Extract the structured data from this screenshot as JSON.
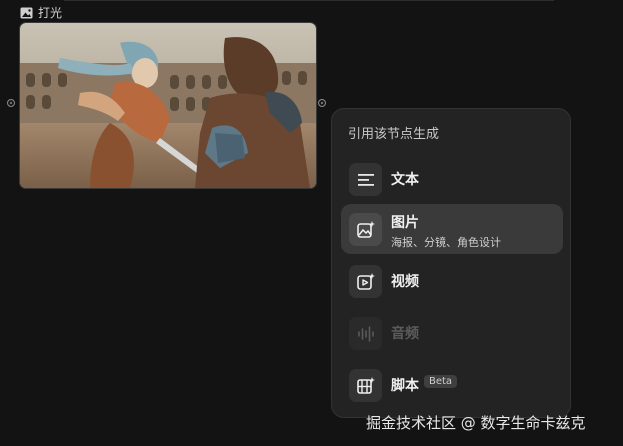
{
  "node": {
    "title": "打光"
  },
  "menu": {
    "title": "引用该节点生成",
    "items": [
      {
        "label": "文本",
        "icon": "text-lines-icon",
        "state": "normal"
      },
      {
        "label": "图片",
        "sub": "海报、分镜、角色设计",
        "icon": "image-sparkle-icon",
        "state": "active"
      },
      {
        "label": "视频",
        "icon": "video-sparkle-icon",
        "state": "normal"
      },
      {
        "label": "音频",
        "icon": "audio-wave-icon",
        "state": "disabled"
      },
      {
        "label": "脚本",
        "badge": "Beta",
        "icon": "film-script-icon",
        "state": "normal"
      }
    ]
  },
  "watermark": "掘金技术社区 @ 数字生命卡兹克"
}
